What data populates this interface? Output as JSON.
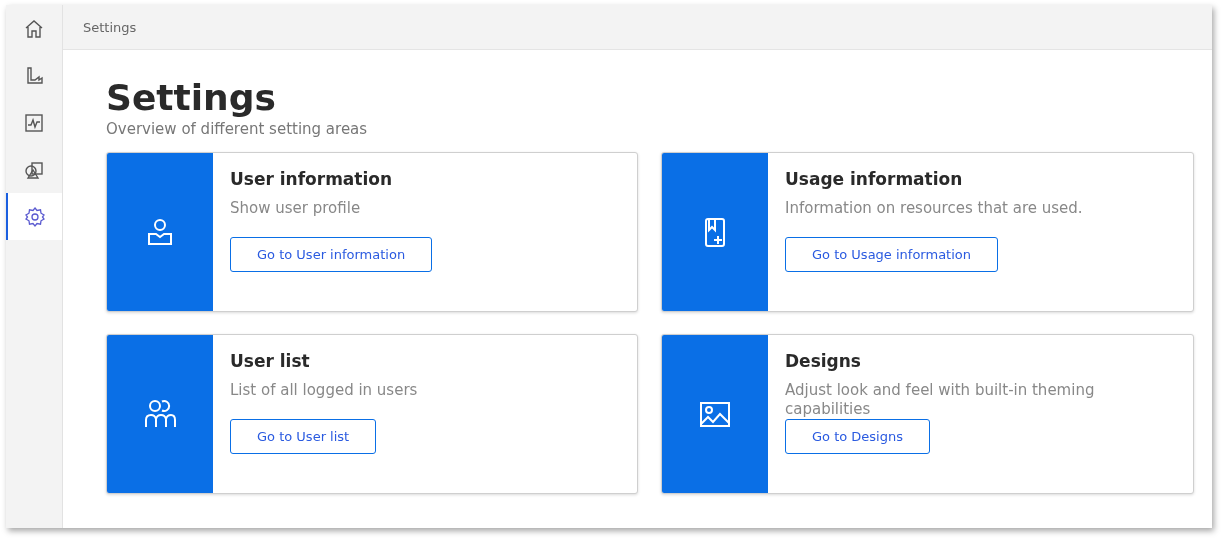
{
  "sidebar": {
    "items": [
      {
        "kind": "home",
        "selected": false
      },
      {
        "kind": "plant",
        "selected": false
      },
      {
        "kind": "monitor",
        "selected": false
      },
      {
        "kind": "shapes",
        "selected": false
      },
      {
        "kind": "settings",
        "selected": true
      }
    ]
  },
  "header": {
    "breadcrumb": "Settings"
  },
  "page": {
    "title": "Settings",
    "subtitle": "Overview of different setting areas"
  },
  "cards": [
    {
      "kind": "user",
      "title": "User information",
      "description": "Show user profile",
      "button": "Go to User information"
    },
    {
      "kind": "usage",
      "title": "Usage information",
      "description": "Information on resources that are used.",
      "button": "Go to Usage information"
    },
    {
      "kind": "users",
      "title": "User list",
      "description": "List of all logged in users",
      "button": "Go to User list"
    },
    {
      "kind": "image",
      "title": "Designs",
      "description": "Adjust look and feel with built-in theming capabilities",
      "button": "Go to Designs"
    }
  ]
}
